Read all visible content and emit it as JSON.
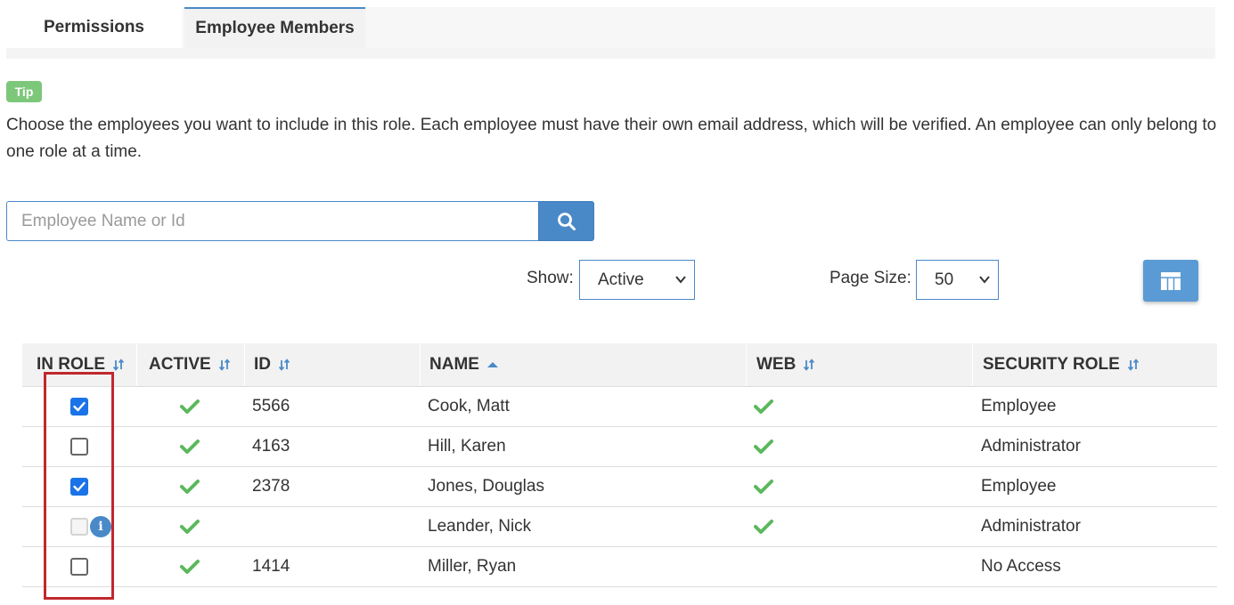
{
  "tabs": [
    {
      "label": "Permissions",
      "active": false
    },
    {
      "label": "Employee Members",
      "active": true
    }
  ],
  "tip": {
    "badge": "Tip",
    "text": "Choose the employees you want to include in this role. Each employee must have their own email address, which will be verified. An employee can only belong to one role at a time."
  },
  "search": {
    "placeholder": "Employee Name or Id",
    "value": "",
    "button_icon": "search-icon"
  },
  "filters": {
    "show_label": "Show:",
    "show_value": "Active",
    "page_size_label": "Page Size:",
    "page_size_value": "50",
    "columns_button_icon": "grid-icon"
  },
  "table": {
    "columns": [
      {
        "label": "IN ROLE",
        "sort": "sortable"
      },
      {
        "label": "ACTIVE",
        "sort": "sortable"
      },
      {
        "label": "ID",
        "sort": "sortable"
      },
      {
        "label": "NAME",
        "sort": "ascending"
      },
      {
        "label": "WEB",
        "sort": "sortable"
      },
      {
        "label": "SECURITY ROLE",
        "sort": "sortable"
      }
    ],
    "rows": [
      {
        "in_role": true,
        "in_role_disabled": false,
        "active": true,
        "id": "5566",
        "name": "Cook, Matt",
        "web": true,
        "security_role": "Employee"
      },
      {
        "in_role": false,
        "in_role_disabled": false,
        "active": true,
        "id": "4163",
        "name": "Hill, Karen",
        "web": true,
        "security_role": "Administrator"
      },
      {
        "in_role": true,
        "in_role_disabled": false,
        "active": true,
        "id": "2378",
        "name": "Jones, Douglas",
        "web": true,
        "security_role": "Employee"
      },
      {
        "in_role": false,
        "in_role_disabled": true,
        "info_icon": "info-icon",
        "active": true,
        "id": "",
        "name": "Leander, Nick",
        "web": true,
        "security_role": "Administrator"
      },
      {
        "in_role": false,
        "in_role_disabled": false,
        "active": true,
        "id": "1414",
        "name": "Miller, Ryan",
        "web": false,
        "security_role": "No Access"
      }
    ]
  },
  "colors": {
    "accent": "#4a89c8",
    "check_green": "#5cb85c",
    "tip_green": "#7dc77b",
    "highlight_red": "#c0282c",
    "checkbox_blue": "#1a73e8"
  }
}
